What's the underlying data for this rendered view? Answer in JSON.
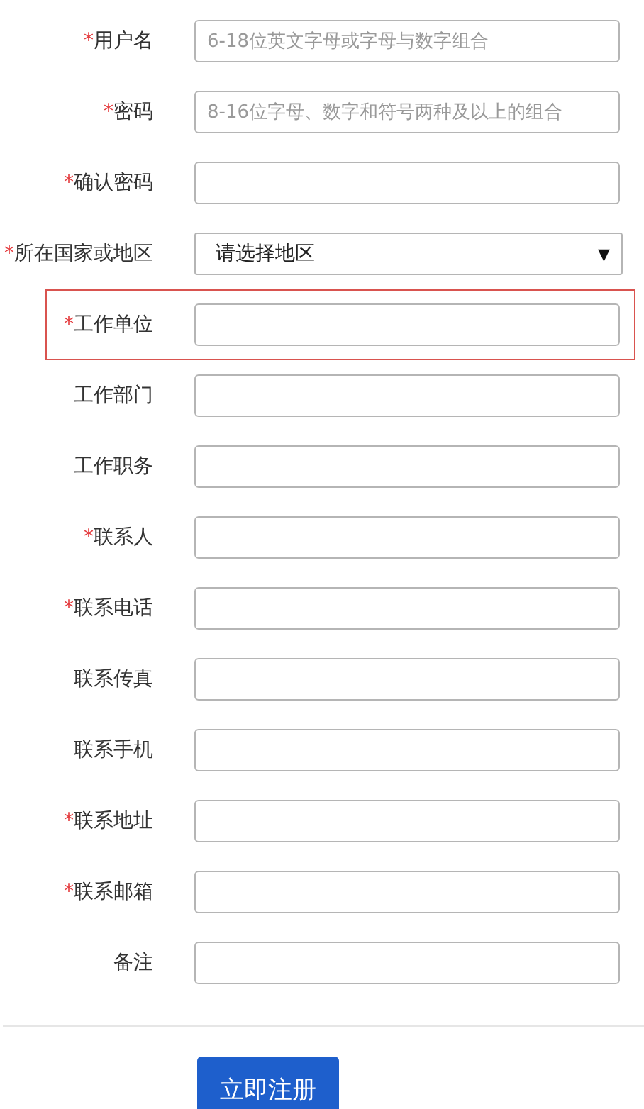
{
  "fields": [
    {
      "kind": "text",
      "label": "用户名",
      "required": true,
      "highlighted": false,
      "placeholder": "6-18位英文字母或字母与数字组合"
    },
    {
      "kind": "text",
      "label": "密码",
      "required": true,
      "highlighted": false,
      "placeholder": "8-16位字母、数字和符号两种及以上的组合"
    },
    {
      "kind": "text",
      "label": "确认密码",
      "required": true,
      "highlighted": false
    },
    {
      "kind": "select",
      "label": "所在国家或地区",
      "required": true,
      "highlighted": false,
      "value": "请选择地区"
    },
    {
      "kind": "text",
      "label": "工作单位",
      "required": true,
      "highlighted": true
    },
    {
      "kind": "text",
      "label": "工作部门",
      "required": false,
      "highlighted": false
    },
    {
      "kind": "text",
      "label": "工作职务",
      "required": false,
      "highlighted": false
    },
    {
      "kind": "text",
      "label": "联系人",
      "required": true,
      "highlighted": false
    },
    {
      "kind": "text",
      "label": "联系电话",
      "required": true,
      "highlighted": false
    },
    {
      "kind": "text",
      "label": "联系传真",
      "required": false,
      "highlighted": false
    },
    {
      "kind": "text",
      "label": "联系手机",
      "required": false,
      "highlighted": false
    },
    {
      "kind": "text",
      "label": "联系地址",
      "required": true,
      "highlighted": false
    },
    {
      "kind": "text",
      "label": "联系邮箱",
      "required": true,
      "highlighted": false
    },
    {
      "kind": "text",
      "label": "备注",
      "required": false,
      "highlighted": false
    }
  ],
  "asterisk": "*",
  "dropdown_arrow": "▼",
  "submit_button": "立即注册"
}
